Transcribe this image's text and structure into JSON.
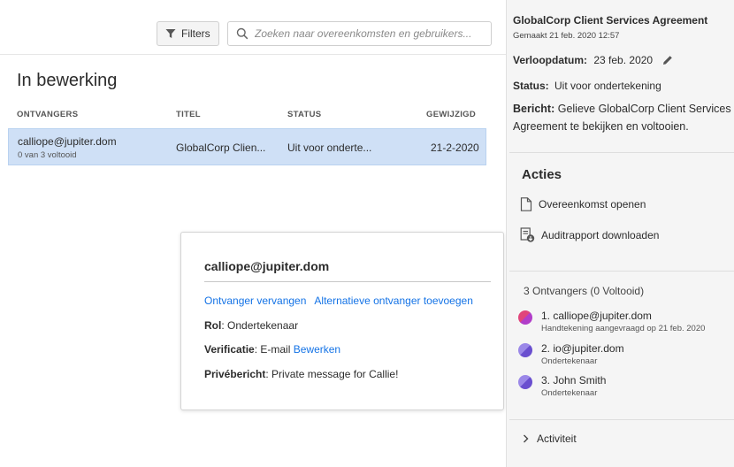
{
  "toolbar": {
    "filters_label": "Filters",
    "search_placeholder": "Zoeken naar overeenkomsten en gebruikers..."
  },
  "list": {
    "title": "In bewerking",
    "columns": [
      "ONTVANGERS",
      "TITEL",
      "STATUS",
      "GEWIJZIGD"
    ],
    "rows": [
      {
        "recipient": "calliope@jupiter.dom",
        "progress": "0 van 3 voltooid",
        "title": "GlobalCorp Clien...",
        "status": "Uit voor onderte...",
        "modified": "21-2-2020"
      }
    ]
  },
  "popover": {
    "email": "calliope@jupiter.dom",
    "replace_link": "Ontvanger vervangen",
    "alt_link": "Alternatieve ontvanger toevoegen",
    "role_label": "Rol",
    "role_value": ": Ondertekenaar",
    "verification_label": "Verificatie",
    "verification_value": ": E-mail ",
    "edit_link": "Bewerken",
    "private_label": "Privébericht",
    "private_value": ": Private message for Callie!"
  },
  "panel": {
    "agreement_title": "GlobalCorp Client Services Agreement",
    "created": "Gemaakt 21 feb. 2020 12:57",
    "expiry_label": "Verloopdatum:",
    "expiry_value": "23 feb. 2020",
    "status_label": "Status:",
    "status_value": "Uit voor ondertekening",
    "message_label": "Bericht:",
    "message_value": "Gelieve GlobalCorp Client Services Agreement te bekijken en voltooien.",
    "actions_title": "Acties",
    "actions": [
      "Overeenkomst openen",
      "Auditrapport downloaden"
    ],
    "recipients_header": "3 Ontvangers (0 Voltooid)",
    "recipients": [
      {
        "name": "1. calliope@jupiter.dom",
        "role": "Handtekening aangevraagd op 21 feb. 2020",
        "color": "#e0457b"
      },
      {
        "name": "2. io@jupiter.dom",
        "role": "Ondertekenaar",
        "color": "#7a5fd6"
      },
      {
        "name": "3. John Smith",
        "role": "Ondertekenaar",
        "color": "#7a5fd6"
      }
    ],
    "activity_label": "Activiteit"
  },
  "colors": {
    "accent": "#1473e6",
    "row_selected": "#cfe0f6",
    "panel_bg": "#f5f5f5"
  }
}
